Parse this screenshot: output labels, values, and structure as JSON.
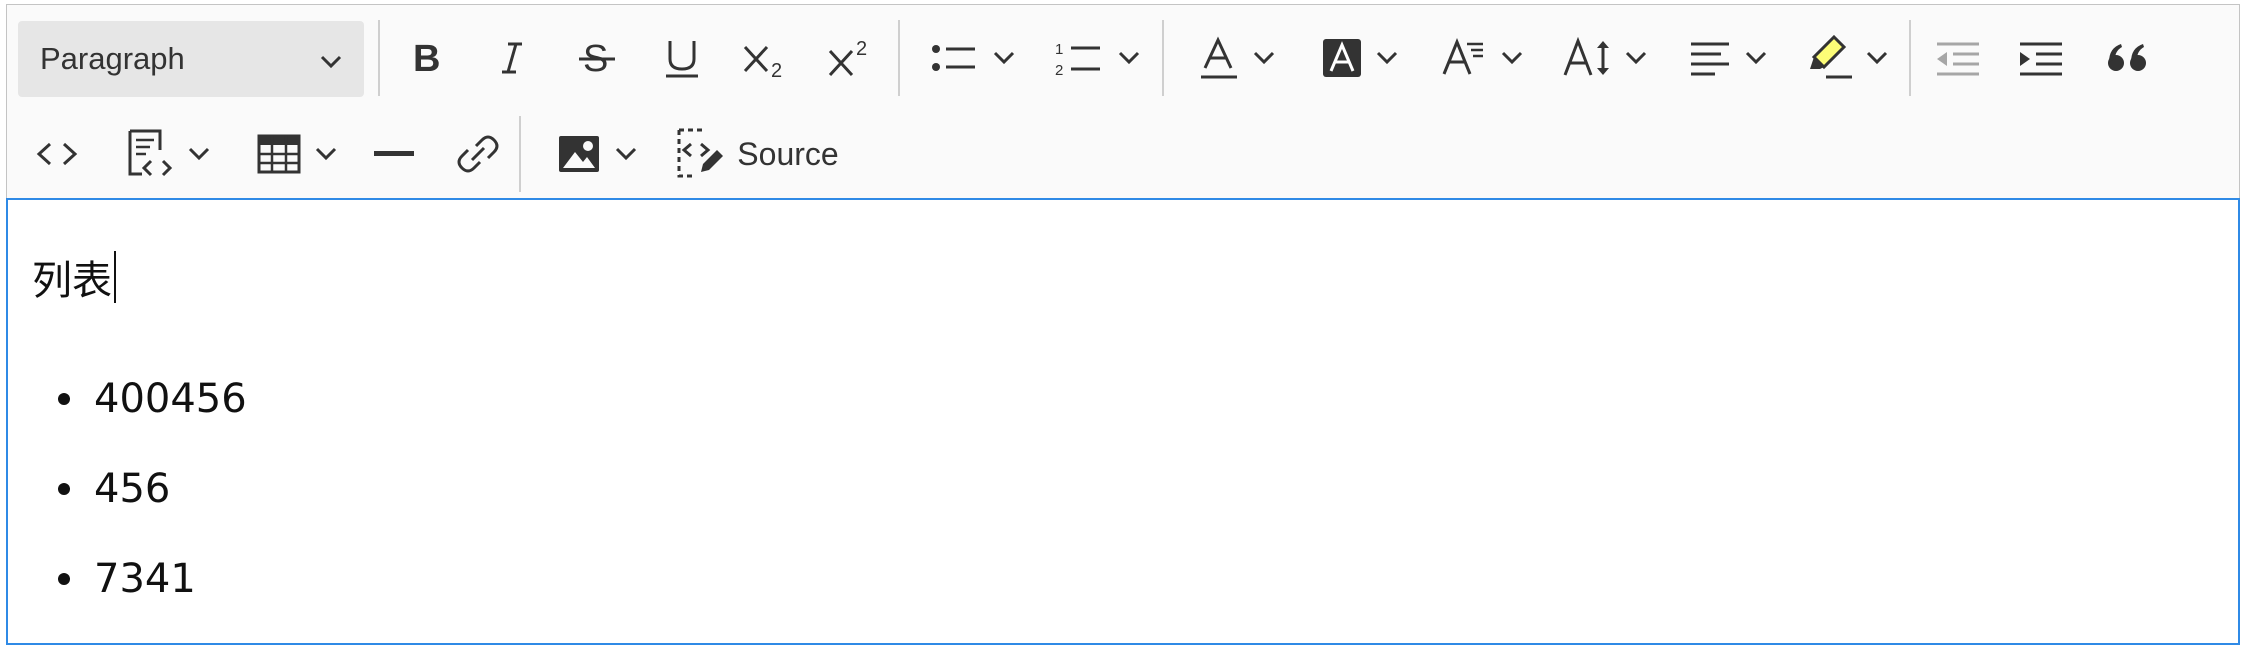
{
  "toolbar": {
    "heading_dropdown": {
      "value": "Paragraph",
      "icon": "chevron-down-icon"
    },
    "buttons": [
      {
        "name": "bold-button",
        "icon": "bold-icon"
      },
      {
        "name": "italic-button",
        "icon": "italic-icon"
      },
      {
        "name": "strikethrough-button",
        "icon": "strikethrough-icon"
      },
      {
        "name": "underline-button",
        "icon": "underline-icon"
      },
      {
        "name": "subscript-button",
        "icon": "subscript-icon"
      },
      {
        "name": "superscript-button",
        "icon": "superscript-icon"
      },
      {
        "name": "bulleted-list-button",
        "icon": "bulleted-list-icon"
      },
      {
        "name": "numbered-list-button",
        "icon": "numbered-list-icon"
      },
      {
        "name": "font-color-button",
        "icon": "font-color-icon"
      },
      {
        "name": "font-background-color-button",
        "icon": "font-background-color-icon"
      },
      {
        "name": "font-family-button",
        "icon": "font-family-icon"
      },
      {
        "name": "font-size-button",
        "icon": "font-size-icon"
      },
      {
        "name": "alignment-button",
        "icon": "align-left-icon"
      },
      {
        "name": "highlight-button",
        "icon": "highlighter-icon"
      },
      {
        "name": "outdent-button",
        "icon": "outdent-icon",
        "disabled": true
      },
      {
        "name": "indent-button",
        "icon": "indent-icon"
      },
      {
        "name": "block-quote-button",
        "icon": "quote-icon"
      },
      {
        "name": "code-button",
        "icon": "code-icon"
      },
      {
        "name": "insert-code-block-button",
        "icon": "code-block-icon"
      },
      {
        "name": "insert-table-button",
        "icon": "table-icon"
      },
      {
        "name": "horizontal-line-button",
        "icon": "horizontal-line-icon"
      },
      {
        "name": "link-button",
        "icon": "link-icon"
      },
      {
        "name": "insert-image-button",
        "icon": "image-icon"
      }
    ],
    "source_label": "Source",
    "colors": {
      "highlight": "#fdfd77",
      "focus_border": "#2f8ae6"
    }
  },
  "content": {
    "title": "列表",
    "list_items": [
      "400456",
      "456",
      "7341"
    ]
  }
}
